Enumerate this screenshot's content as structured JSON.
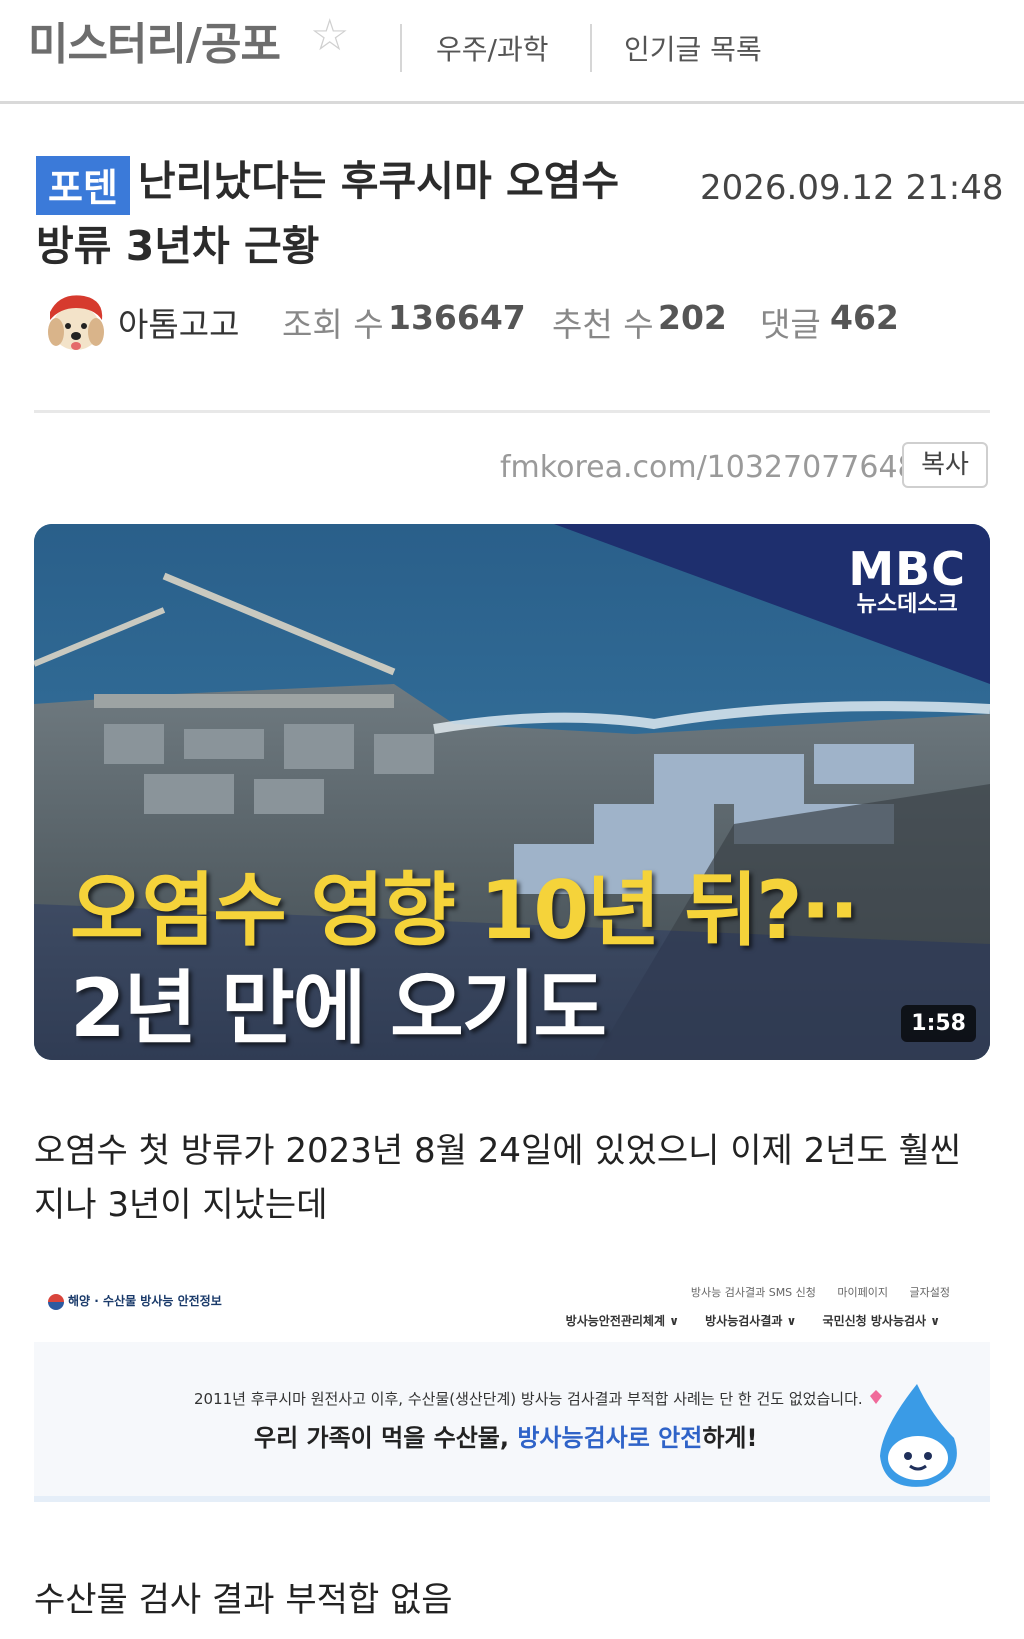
{
  "nav": {
    "board_title": "미스터리/공포",
    "link_science": "우주/과학",
    "link_popular": "인기글 목록"
  },
  "post": {
    "badge": "포텐",
    "title_line1": "난리났다는 후쿠시마 오염수",
    "title_line2": "방류 3년차 근황",
    "date": "2026.09.12 21:48",
    "author": "아톰고고",
    "views_label": "조회 수",
    "views": "136647",
    "likes_label": "추천 수",
    "likes": "202",
    "comments_label": "댓글",
    "comments": "462",
    "url": "fmkorea.com/10327077648",
    "copy_label": "복사"
  },
  "video": {
    "logo": "MBC",
    "logo_sub": "뉴스데스크",
    "caption_line1": "오염수 영향 10년 뒤?··",
    "caption_line2": "2년 만에 오기도",
    "duration": "1:58"
  },
  "content": {
    "paragraph1": "오염수 첫 방류가 2023년 8월 24일에 있었으니 이제 2년도 훨씬 지나 3년이 지났는데",
    "paragraph2": "수산물 검사 결과 부적합 없음"
  },
  "embed": {
    "site_name": "해양 · 수산물 방사능 안전정보",
    "util_items": [
      "방사능 검사결과 SMS 신청",
      "마이페이지",
      "글자설정"
    ],
    "menu_items": [
      "방사능안전관리체계 ∨",
      "방사능검사결과 ∨",
      "국민신청 방사능검사 ∨"
    ],
    "notice": "2011년 후쿠시마 원전사고 이후, 수산물(생산단계) 방사능 검사결과 부적합 사례는 단 한 건도 없었습니다.",
    "slogan_pre": "우리 가족이 먹을 수산물, ",
    "slogan_hl": "방사능검사로 안전",
    "slogan_post": "하게!"
  }
}
